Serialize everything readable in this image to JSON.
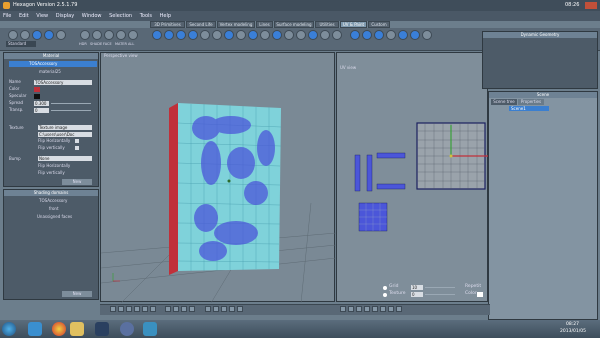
{
  "window": {
    "title": "Hexagon Version 2.5.1.79",
    "clock": "08:26"
  },
  "menu": [
    "File",
    "Edit",
    "View",
    "Display",
    "Window",
    "Selection",
    "Tools",
    "Help"
  ],
  "tabs": [
    {
      "label": "3D Primitives",
      "active": false
    },
    {
      "label": "Second Life",
      "active": false
    },
    {
      "label": "Vertex modeling",
      "active": false
    },
    {
      "label": "Lines",
      "active": false
    },
    {
      "label": "Surface modeling",
      "active": false
    },
    {
      "label": "Utilities",
      "active": false
    },
    {
      "label": "UV & Paint",
      "active": true
    },
    {
      "label": "Custom",
      "active": false
    }
  ],
  "toolbar": {
    "standard_label": "Standard",
    "labels": [
      "HDR",
      "SHADE",
      "FACE",
      "MATER",
      "ALL"
    ]
  },
  "material_panel": {
    "title": "Material",
    "items": [
      "TOSAccessory",
      "material25"
    ],
    "name_label": "Name",
    "name_value": "TOSAccessory",
    "color_label": "Color",
    "specular_label": "Specular",
    "spread_label": "Spread",
    "spread_value": "0.300",
    "transp_label": "Transp.",
    "transp_value": "0",
    "texture_label": "Texture",
    "texture_type": "Texture image",
    "texture_path": "C:\\users\\user\\Doc",
    "flip_h": "Flip Horizontally",
    "flip_v": "Flip vertically",
    "bump_label": "Bump",
    "bump_value": "None",
    "new_button": "New"
  },
  "shading_panel": {
    "title": "Shading domains",
    "items": [
      "TOSAccessory",
      "front",
      "Unassigned faces"
    ],
    "new_button": "New"
  },
  "viewports": {
    "perspective": "Perspective view",
    "uv": "UV view"
  },
  "uv_bottom": {
    "grid_label": "Grid",
    "grid_value": "10",
    "texture_label": "Texture",
    "texture_value": "0",
    "repeat_label": "Repetit",
    "color_label": "Color"
  },
  "dynamic_geometry": {
    "title": "Dynamic Geometry"
  },
  "scene_panel": {
    "title": "Scene",
    "tabs": [
      "Scene tree",
      "Properties"
    ],
    "tree_item": "Scene1"
  },
  "taskbar": {
    "time": "08:27",
    "date": "2013/01/05"
  },
  "colors": {
    "accent": "#3a7fd8",
    "texture_blue": "#4b56d9",
    "mesh_cyan": "#7fd2da",
    "edge_red": "#c0303a"
  }
}
